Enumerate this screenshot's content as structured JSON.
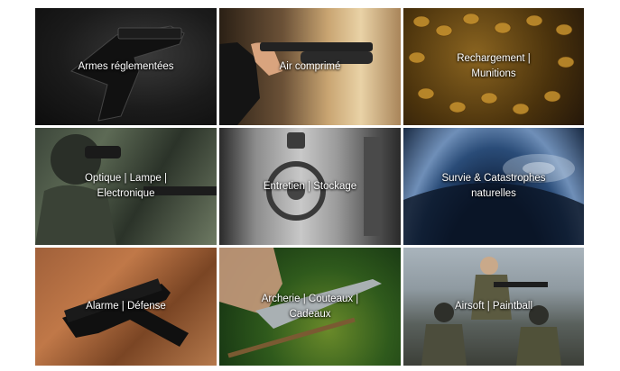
{
  "categories": [
    {
      "label": "Armes réglementées",
      "icon": "pistol-icon"
    },
    {
      "label": "Air comprimé",
      "icon": "air-pistol-icon"
    },
    {
      "label": "Rechargement | Munitions",
      "icon": "ammunition-icon"
    },
    {
      "label": "Optique | Lampe | Electronique",
      "icon": "soldier-optics-icon"
    },
    {
      "label": "Entretien | Stockage",
      "icon": "safe-vault-icon"
    },
    {
      "label": "Survie & Catastrophes naturelles",
      "icon": "hurricane-icon"
    },
    {
      "label": "Alarme | Défense",
      "icon": "handgun-icon"
    },
    {
      "label": "Archerie | Couteaux | Cadeaux",
      "icon": "knife-icon"
    },
    {
      "label": "Airsoft | Paintball",
      "icon": "airsoft-players-icon"
    }
  ]
}
